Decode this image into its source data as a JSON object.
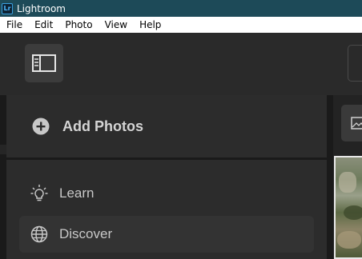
{
  "window": {
    "app_icon_text": "Lr",
    "title": "Lightroom"
  },
  "menubar": {
    "items": [
      "File",
      "Edit",
      "Photo",
      "View",
      "Help"
    ]
  },
  "left_panel": {
    "add_photos_label": "Add Photos",
    "nav": [
      {
        "label": "Learn",
        "icon": "lightbulb-icon"
      },
      {
        "label": "Discover",
        "icon": "globe-icon",
        "selected": true
      }
    ]
  },
  "colors": {
    "titlebar": "#1d4a58",
    "panel": "#2c2c2c",
    "text": "#d4d4d4"
  }
}
